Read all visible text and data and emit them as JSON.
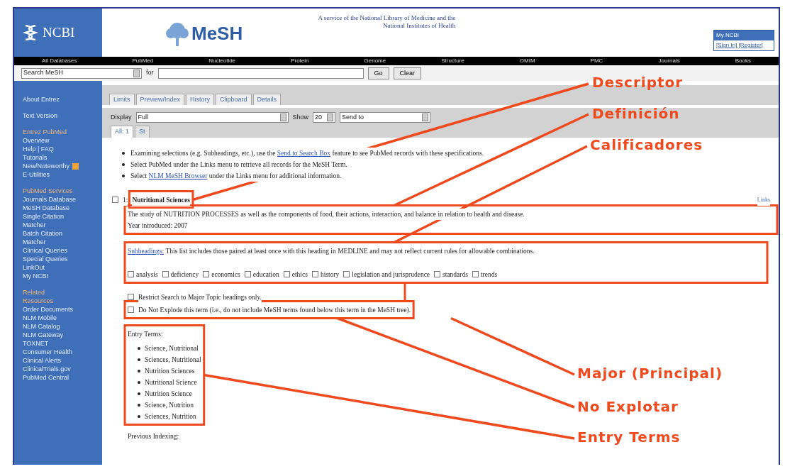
{
  "header": {
    "logo": "NCBI",
    "product": "MeSH",
    "service": "A service of the National Library of Medicine and the National Institutes of Health",
    "my_ncbi": {
      "title": "My NCBI",
      "links": [
        "[Sign In] [Register]"
      ]
    }
  },
  "nav": [
    "All Databases",
    "PubMed",
    "Nucleotide",
    "Protein",
    "Genome",
    "Structure",
    "OMIM",
    "PMC",
    "Journals",
    "Books"
  ],
  "search": {
    "database": "Search MeSH",
    "for_label": "for",
    "buttons": [
      "Go",
      "Clear"
    ]
  },
  "tabs": [
    {
      "label": "Limits",
      "selected": false
    },
    {
      "label": "Preview/Index",
      "selected": false
    },
    {
      "label": "History",
      "selected": false
    },
    {
      "label": "Clipboard",
      "selected": false
    },
    {
      "label": "Details",
      "selected": false
    }
  ],
  "display": {
    "label": "Display",
    "value": "Full",
    "show_label": "Show",
    "show_value": "20",
    "send_to": "Send to"
  },
  "subtabs": [
    {
      "label": "All: 1",
      "selected": true
    },
    {
      "label": "St",
      "selected": false
    }
  ],
  "sidebar": [
    {
      "kind": "link",
      "label": "About Entrez"
    },
    {
      "kind": "gap"
    },
    {
      "kind": "link",
      "label": "Text Version"
    },
    {
      "kind": "gap"
    },
    {
      "kind": "heading",
      "label": "Entrez PubMed"
    },
    {
      "kind": "link",
      "label": "Overview"
    },
    {
      "kind": "link",
      "label": "Help | FAQ"
    },
    {
      "kind": "link",
      "label": "Tutorials"
    },
    {
      "kind": "rss",
      "label": "New/Noteworthy"
    },
    {
      "kind": "link",
      "label": "E-Utilities"
    },
    {
      "kind": "gap"
    },
    {
      "kind": "heading",
      "label": "PubMed Services"
    },
    {
      "kind": "link",
      "label": "Journals Database"
    },
    {
      "kind": "link",
      "label": "MeSH Database"
    },
    {
      "kind": "link",
      "label": "Single Citation"
    },
    {
      "kind": "link",
      "label": "Matcher"
    },
    {
      "kind": "link",
      "label": "Batch Citation"
    },
    {
      "kind": "link",
      "label": "Matcher"
    },
    {
      "kind": "link",
      "label": "Clinical Queries"
    },
    {
      "kind": "link",
      "label": "Special Queries"
    },
    {
      "kind": "link",
      "label": "LinkOut"
    },
    {
      "kind": "link",
      "label": "My NCBI"
    },
    {
      "kind": "gap"
    },
    {
      "kind": "heading",
      "label": "Related"
    },
    {
      "kind": "heading",
      "label": "Resources"
    },
    {
      "kind": "link",
      "label": "Order Documents"
    },
    {
      "kind": "link",
      "label": "NLM Mobile"
    },
    {
      "kind": "link",
      "label": "NLM Catalog"
    },
    {
      "kind": "link",
      "label": "NLM Gateway"
    },
    {
      "kind": "link",
      "label": "TOXNET"
    },
    {
      "kind": "link",
      "label": "Consumer Health"
    },
    {
      "kind": "link",
      "label": "Clinical Alerts"
    },
    {
      "kind": "link",
      "label": "ClinicalTrials.gov"
    },
    {
      "kind": "link",
      "label": "PubMed Central"
    }
  ],
  "notes": [
    {
      "before": "Examining selections (e.g. Subheadings, etc.), use the ",
      "link": "Send to Search Box",
      "after": " feature to see PubMed records with these specifications."
    },
    {
      "before": "Select PubMed under the Links menu to retrieve all records for the MeSH Term."
    },
    {
      "before": "Select ",
      "link": "NLM MeSH Browser",
      "after": " under the Links menu for additional information."
    }
  ],
  "record": {
    "number": "1:",
    "checked": false,
    "term": "Nutritional Sciences",
    "links": "Links",
    "definition": "The study of NUTRITION PROCESSES as well as the components of food, their actions, interaction, and balance in relation to health and disease.",
    "year": "Year introduced: 2007",
    "subheadings_link": "Subheadings:",
    "subheadings_text": "This list includes those paired at least once with this heading in MEDLINE and may not reflect current rules for allowable combinations.",
    "subheadings": [
      {
        "label": "analysis",
        "checked": false
      },
      {
        "label": "deficiency",
        "checked": false
      },
      {
        "label": "economics",
        "checked": false
      },
      {
        "label": "education",
        "checked": false
      },
      {
        "label": "ethics",
        "checked": false
      },
      {
        "label": "history",
        "checked": false
      },
      {
        "label": "legislation and jurisprudence",
        "checked": false
      },
      {
        "label": "standards",
        "checked": false
      },
      {
        "label": "trends",
        "checked": false
      }
    ],
    "options": [
      {
        "label": "Restrict Search to Major Topic headings only.",
        "checked": false
      },
      {
        "label": "Do Not Explode this term (i.e., do not include MeSH terms found below this term in the MeSH tree).",
        "checked": false
      }
    ],
    "entry_title": "Entry Terms:",
    "entry_terms": [
      "Science, Nutritional",
      "Sciences, Nutritional",
      "Nutrition Sciences",
      "Nutritional Science",
      "Nutrition Science",
      "Science, Nutrition",
      "Sciences, Nutrition"
    ],
    "previous": "Previous Indexing:"
  },
  "annotations": [
    {
      "label": "Descriptor"
    },
    {
      "label": "Definición"
    },
    {
      "label": "Calificadores"
    },
    {
      "label": "Major (Principal)"
    },
    {
      "label": "No Explotar"
    },
    {
      "label": "Entry Terms"
    }
  ]
}
